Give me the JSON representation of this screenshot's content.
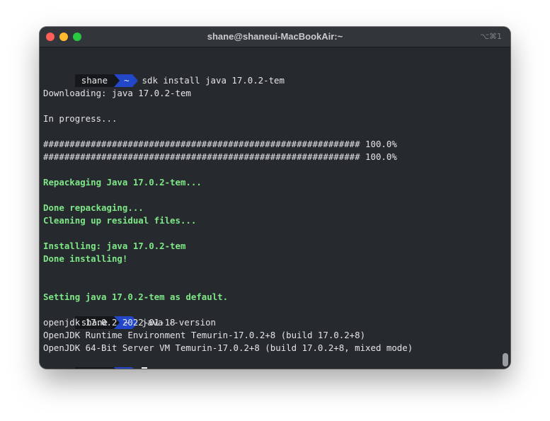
{
  "window": {
    "title": "shane@shaneui-MacBookAir:~",
    "shortcut": "⌥⌘1"
  },
  "prompt": {
    "user": "shane",
    "dir": "~"
  },
  "terminal": {
    "cmd1": "sdk install java 17.0.2-tem",
    "downloading": "Downloading: java 17.0.2-tem",
    "progress_label": "In progress...",
    "progress_bar_1": "############################################################ 100.0%",
    "progress_bar_2": "############################################################ 100.0%",
    "repackaging": "Repackaging Java 17.0.2-tem...",
    "done_repackaging": "Done repackaging...",
    "cleaning": "Cleaning up residual files...",
    "installing": "Installing: java 17.0.2-tem",
    "done_installing": "Done installing!",
    "setting_default": "Setting java 17.0.2-tem as default.",
    "cmd2": "java --version",
    "version_line_1": "openjdk 17.0.2 2022-01-18",
    "version_line_2": "OpenJDK Runtime Environment Temurin-17.0.2+8 (build 17.0.2+8)",
    "version_line_3": "OpenJDK 64-Bit Server VM Temurin-17.0.2+8 (build 17.0.2+8, mixed mode)"
  },
  "colors": {
    "background": "#26292d",
    "success_text": "#7ee787",
    "prompt_user_bg": "#15171a",
    "prompt_dir_bg": "#2347c9"
  }
}
